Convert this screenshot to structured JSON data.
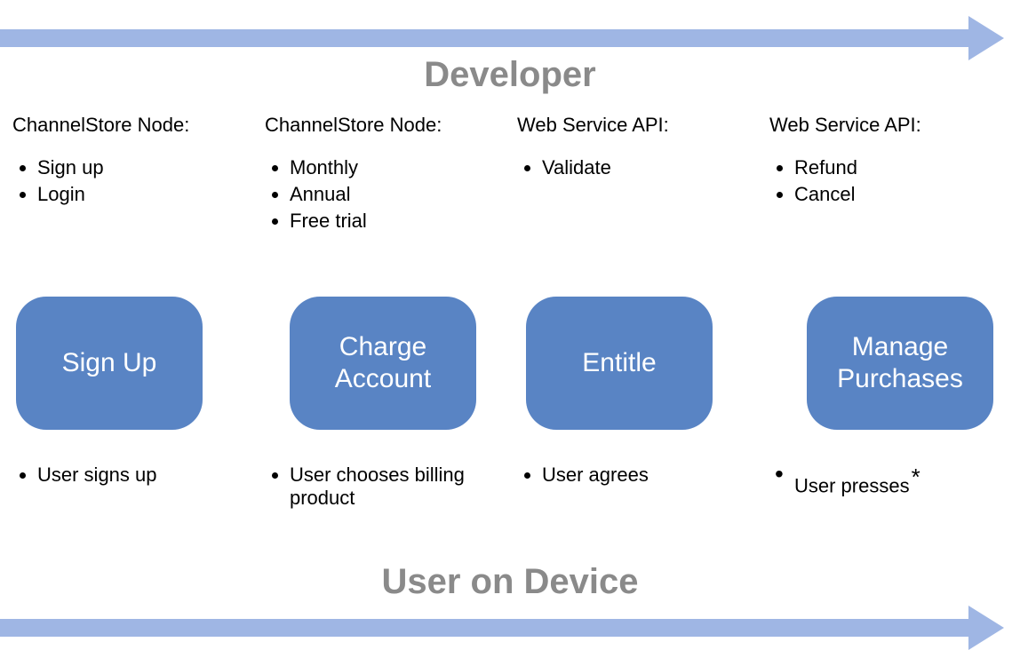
{
  "top_label": "Developer",
  "bottom_label": "User on Device",
  "columns": [
    {
      "dev_heading": "ChannelStore Node:",
      "dev_items": [
        "Sign up",
        "Login"
      ],
      "stage": "Sign Up",
      "user_items": [
        "User signs up"
      ],
      "user_asterisk": false
    },
    {
      "dev_heading": "ChannelStore Node:",
      "dev_items": [
        "Monthly",
        "Annual",
        "Free trial"
      ],
      "stage": "Charge Account",
      "user_items": [
        "User chooses billing product"
      ],
      "user_asterisk": false
    },
    {
      "dev_heading": "Web Service API:",
      "dev_items": [
        "Validate"
      ],
      "stage": "Entitle",
      "user_items": [
        "User agrees"
      ],
      "user_asterisk": false
    },
    {
      "dev_heading": "Web Service API:",
      "dev_items": [
        "Refund",
        "Cancel"
      ],
      "stage": "Manage Purchases",
      "user_items": [
        "User presses"
      ],
      "user_asterisk": true
    }
  ]
}
